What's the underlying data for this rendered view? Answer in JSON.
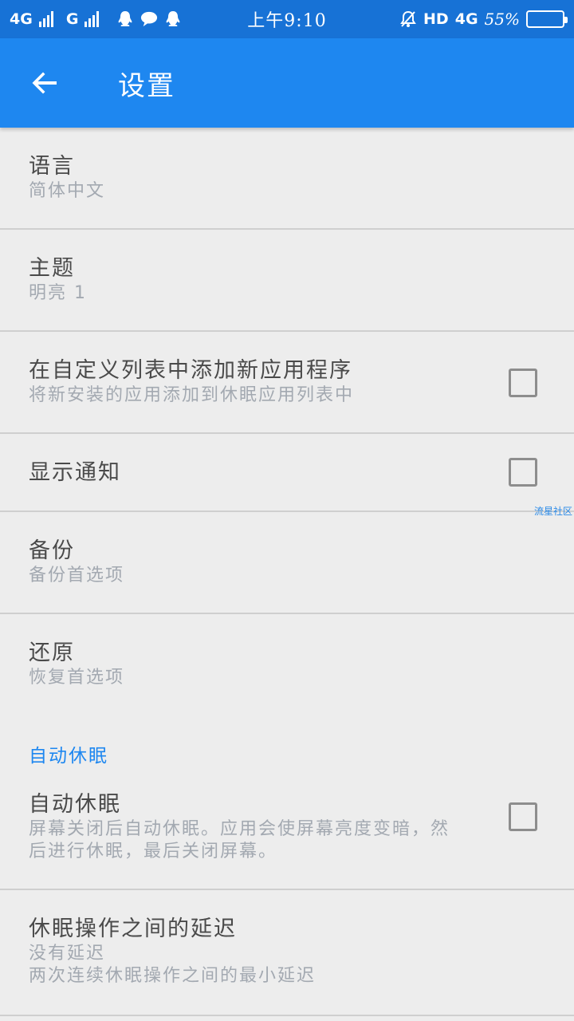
{
  "status_bar": {
    "network1": "4G",
    "network2": "G",
    "time": "上午9:10",
    "hd": "HD",
    "network3": "4G",
    "battery_text": "55%",
    "battery_level": 0.55,
    "icons": [
      "qq-icon",
      "message-bubble-icon",
      "qq-icon",
      "silent-bell-icon"
    ]
  },
  "app_bar": {
    "title": "设置"
  },
  "settings": {
    "language": {
      "title": "语言",
      "value": "简体中文"
    },
    "theme": {
      "title": "主题",
      "value": "明亮 1"
    },
    "add_new_apps": {
      "title": "在自定义列表中添加新应用程序",
      "desc": "将新安装的应用添加到休眠应用列表中",
      "checked": false
    },
    "show_notification": {
      "title": "显示通知",
      "checked": false
    },
    "backup": {
      "title": "备份",
      "desc": "备份首选项"
    },
    "restore": {
      "title": "还原",
      "desc": "恢复首选项"
    },
    "auto_hibernate_header": "自动休眠",
    "auto_hibernate": {
      "title": "自动休眠",
      "desc": "屏幕关闭后自动休眠。应用会使屏幕亮度变暗，然后进行休眠，最后关闭屏幕。",
      "checked": false
    },
    "delay": {
      "title": "休眠操作之间的延迟",
      "value": "没有延迟",
      "desc": "两次连续休眠操作之间的最小延迟"
    }
  },
  "watermark": "流星社区",
  "colors": {
    "status_bar": "#1772d6",
    "app_bar": "#1e87f0",
    "background": "#ededed",
    "accent": "#1e87f0"
  }
}
